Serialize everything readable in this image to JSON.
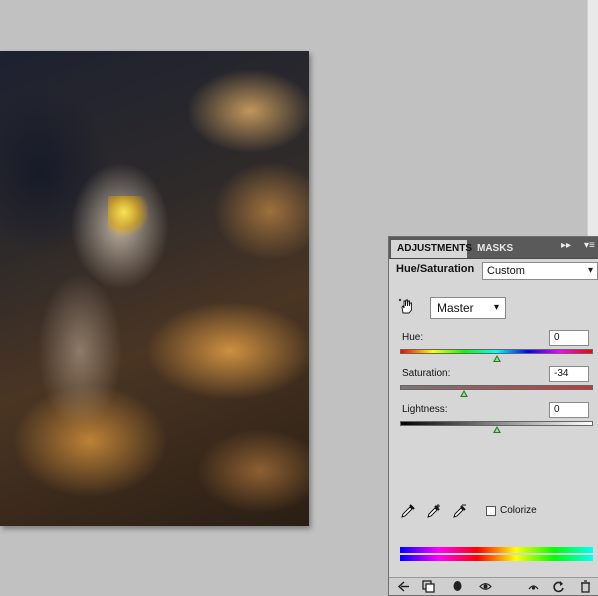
{
  "panel": {
    "tabs": [
      {
        "label": "ADJUSTMENTS",
        "active": true
      },
      {
        "label": "MASKS",
        "active": false
      }
    ],
    "menu_glyph": "▸▸",
    "title": "Hue/Saturation",
    "preset": "Custom",
    "channel": "Master",
    "hue": {
      "label": "Hue:",
      "value": "0",
      "position": 0.5
    },
    "saturation": {
      "label": "Saturation:",
      "value": "-34",
      "position": 0.33
    },
    "lightness": {
      "label": "Lightness:",
      "value": "0",
      "position": 0.5
    },
    "colorize_label": "Colorize",
    "colorize_checked": false
  },
  "icons": {
    "tool": "hand-scrubby-icon",
    "droppers": [
      "eyedropper-icon",
      "eyedropper-plus-icon",
      "eyedropper-minus-icon"
    ],
    "footer": [
      "back-arrow-icon",
      "clip-to-layer-icon",
      "mask-icon",
      "eye-icon",
      "view-previous-icon",
      "reset-icon",
      "trash-icon"
    ]
  },
  "colors": {
    "panel_bg": "#d6d6d6",
    "tabbar_bg": "#5a5a5a",
    "thumb": "#2a7a2a"
  }
}
